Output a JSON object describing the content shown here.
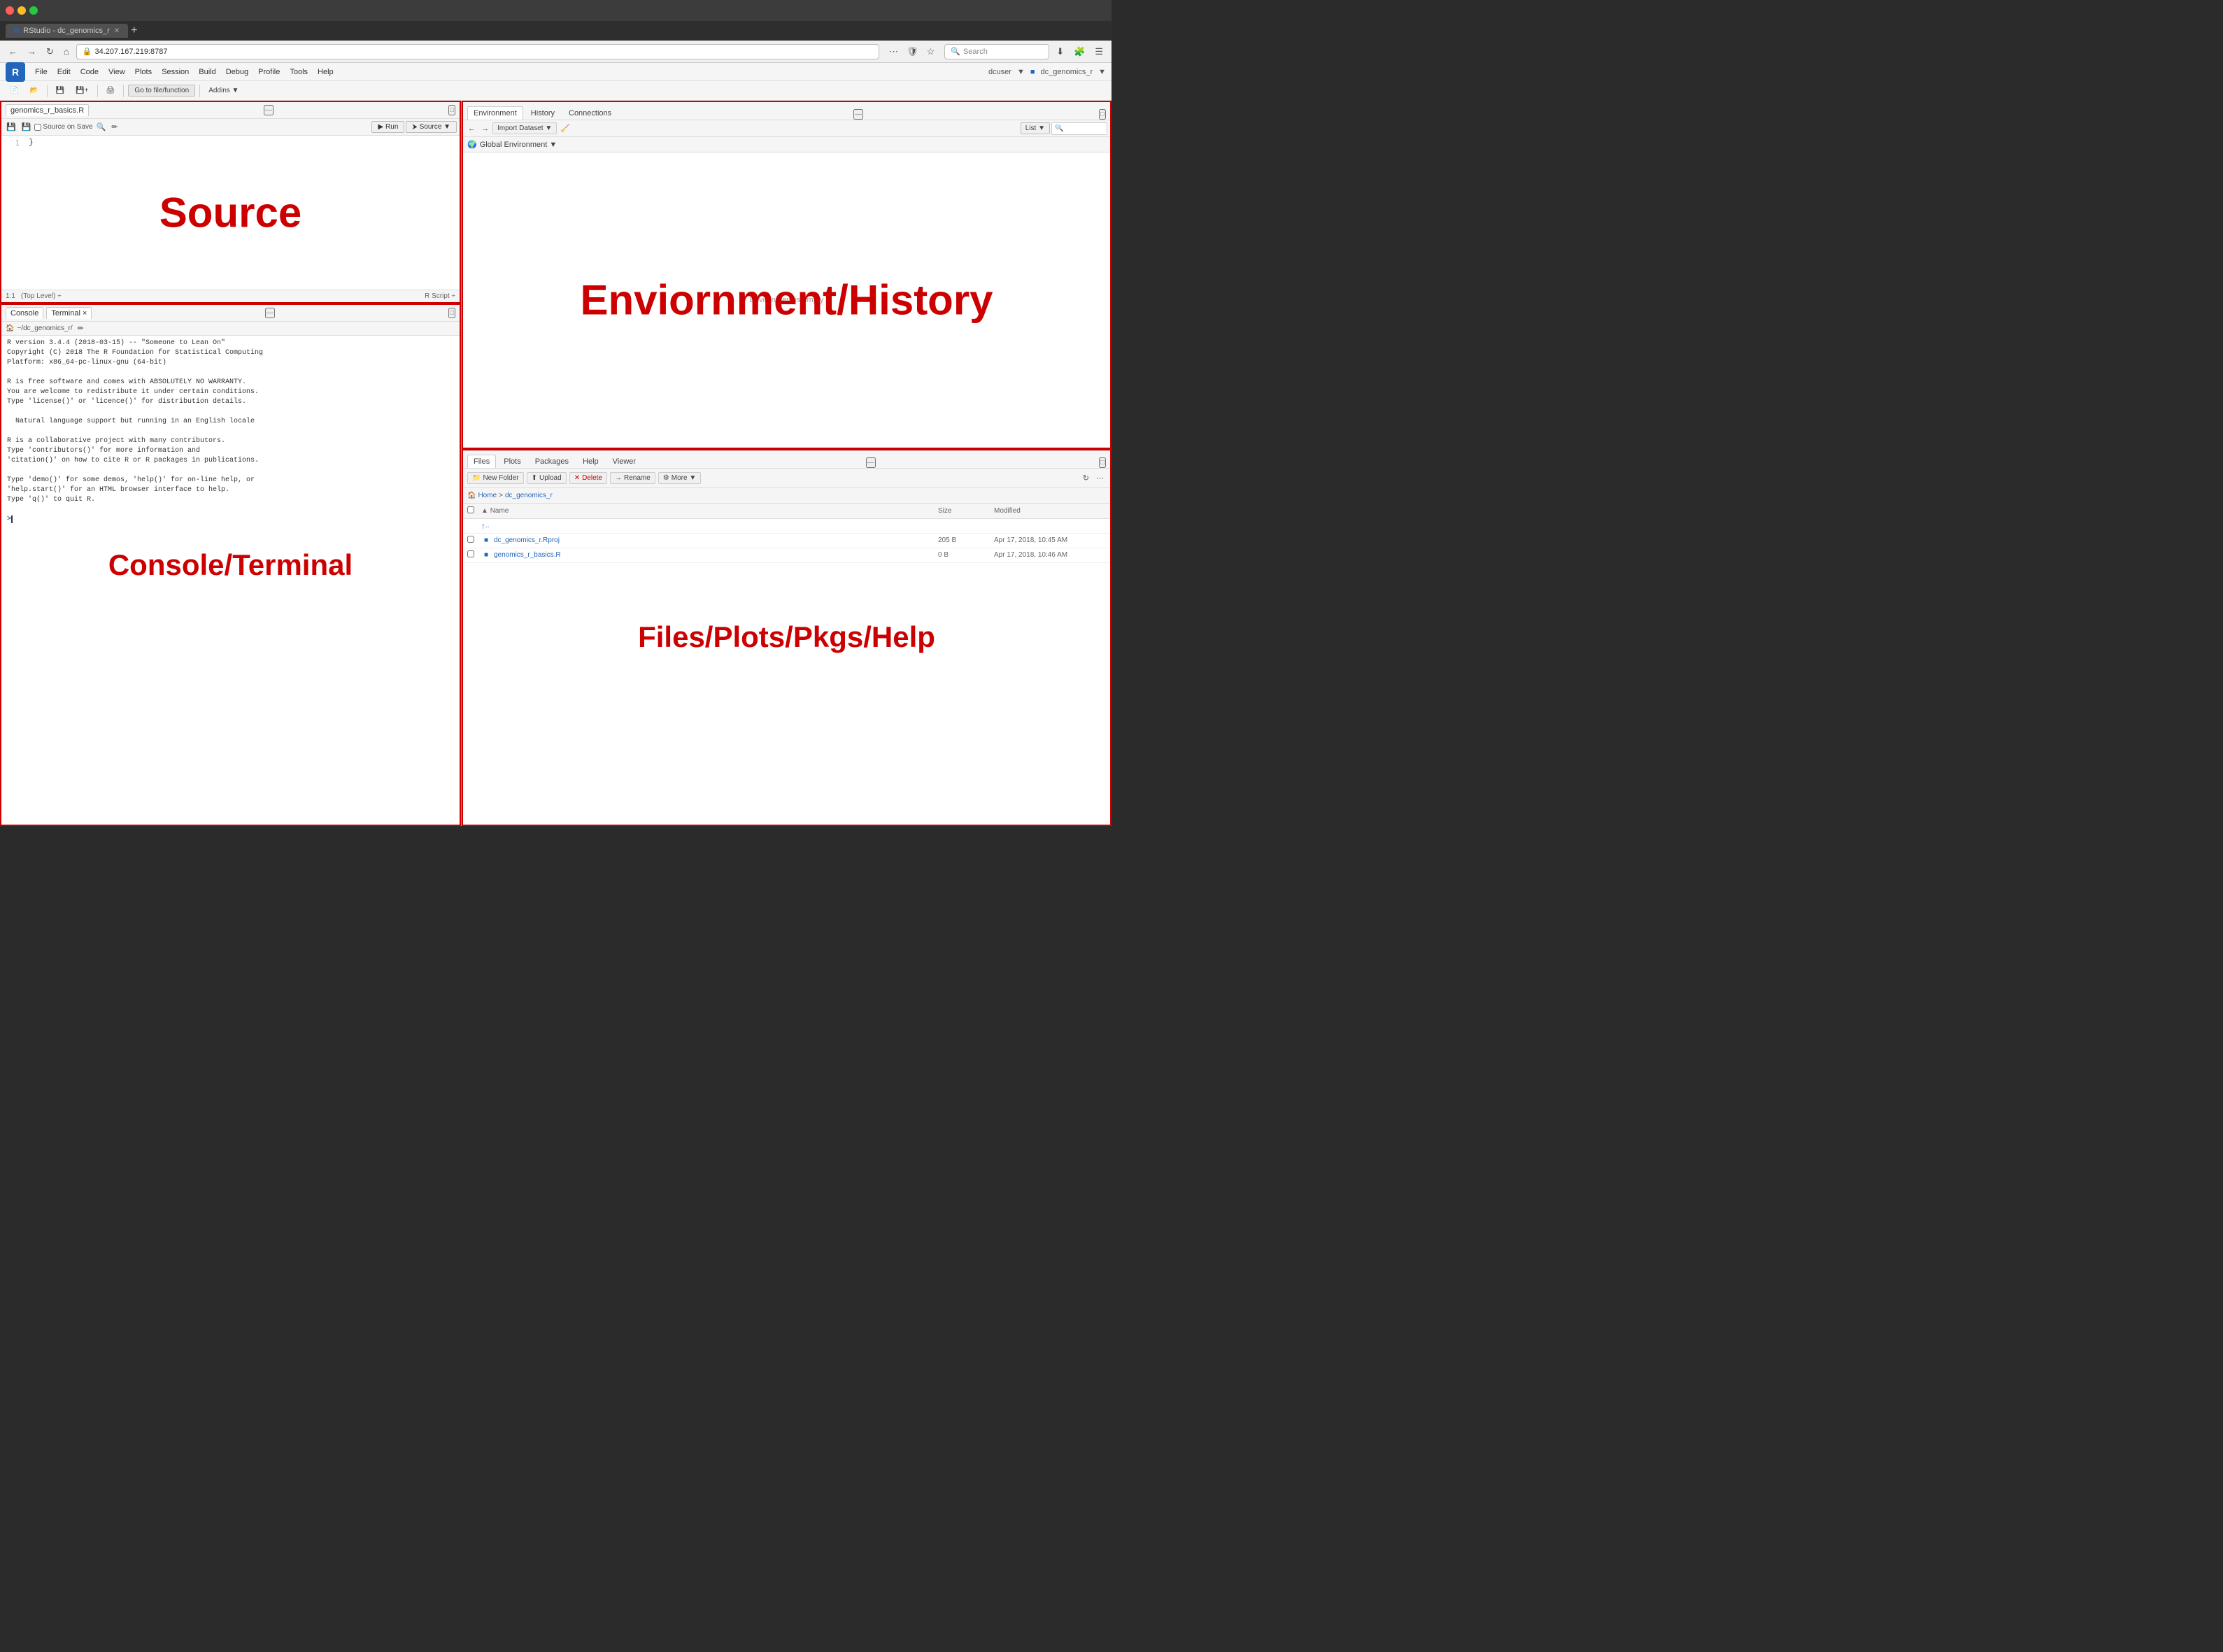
{
  "browser": {
    "traffic_lights": [
      "red",
      "yellow",
      "green"
    ],
    "tab_title": "RStudio - dc_genomics_r",
    "address": "34.207.167.219:8787",
    "search_placeholder": "Search",
    "nav_back": "←",
    "nav_forward": "→",
    "nav_refresh": "↻",
    "nav_home": "⌂"
  },
  "rstudio": {
    "title": "RStudio - dc_genomics_r",
    "r_logo": "R",
    "menu_items": [
      "File",
      "Edit",
      "Code",
      "View",
      "Plots",
      "Session",
      "Build",
      "Debug",
      "Profile",
      "Tools",
      "Help"
    ],
    "user": "dcuser",
    "project": "dc_genomics_r",
    "toolbar": {
      "goto_label": "Go to file/function",
      "addins_label": "Addins ▼"
    }
  },
  "source_panel": {
    "tab_label": "genomics_r_basics.R",
    "overlay_text": "Source",
    "source_on_save": "Source on Save",
    "run_btn": "Run",
    "source_btn": "Source ▼",
    "line_number": "1",
    "code_line1": "",
    "code_line2": "}",
    "status_position": "1:1",
    "status_level": "(Top Level) ÷",
    "status_right": "R Script ÷"
  },
  "console_panel": {
    "tabs": [
      "Console",
      "Terminal ×"
    ],
    "path": "~/dc_genomics_r/",
    "overlay_text": "Console/Terminal",
    "content": [
      "R version 3.4.4 (2018-03-15) -- \"Someone to Lean On\"",
      "Copyright (C) 2018 The R Foundation for Statistical Computing",
      "Platform: x86_64-pc-linux-gnu (64-bit)",
      "",
      "R is free software and comes with ABSOLUTELY NO WARRANTY.",
      "You are welcome to redistribute it under certain conditions.",
      "Type 'license()' or 'licence()' for distribution details.",
      "",
      "  Natural language support but running in an English locale",
      "",
      "R is a collaborative project with many contributors.",
      "Type 'contributors()' for more information and",
      "'citation()' on how to cite R or R packages in publications.",
      "",
      "Type 'demo()' for some demos, 'help()' for on-line help, or",
      "'help.start()' for an HTML browser interface to help.",
      "Type 'q()' to quit R.",
      ""
    ],
    "prompt": "> "
  },
  "env_panel": {
    "tabs": [
      "Environment",
      "History",
      "Connections"
    ],
    "overlay_text": "Enviornment/History",
    "active_tab": "Environment",
    "import_dataset_btn": "Import Dataset ▼",
    "list_btn": "List ▼",
    "global_env_label": "Global Environment ▼",
    "empty_msg": "Environment is empty",
    "search_placeholder": "🔍"
  },
  "files_panel": {
    "tabs": [
      "Files",
      "Plots",
      "Packages",
      "Help",
      "Viewer"
    ],
    "overlay_text": "Files/Plots/Pkgs/Help",
    "active_tab": "Files",
    "toolbar": {
      "new_folder": "New Folder",
      "upload": "Upload",
      "delete": "Delete",
      "rename": "Rename",
      "more": "More ▼"
    },
    "breadcrumb": {
      "home": "Home",
      "separator": ">",
      "folder": "dc_genomics_r"
    },
    "columns": {
      "name": "Name",
      "size": "Size",
      "modified": "Modified"
    },
    "rows": [
      {
        "icon": "↑",
        "name": "..",
        "size": "",
        "modified": ""
      },
      {
        "icon": "📄",
        "name": "dc_genomics_r.Rproj",
        "size": "205 B",
        "modified": "Apr 17, 2018, 10:45 AM"
      },
      {
        "icon": "📄",
        "name": "genomics_r_basics.R",
        "size": "0 B",
        "modified": "Apr 17, 2018, 10:46 AM"
      }
    ]
  }
}
